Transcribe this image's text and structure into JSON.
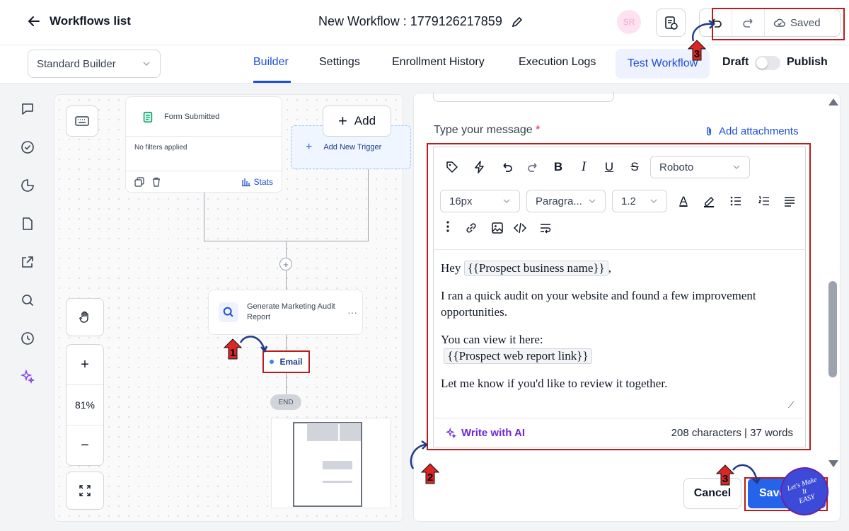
{
  "header": {
    "back_label": "Workflows list",
    "workflow_title": "New Workflow : 1779126217859",
    "avatar_initials": "SR",
    "saved_label": "Saved"
  },
  "tabs": {
    "builder_select": "Standard Builder",
    "items": [
      "Builder",
      "Settings",
      "Enrollment History",
      "Execution Logs"
    ],
    "active": "Builder",
    "test_button": "Test Workflow",
    "draft_label": "Draft",
    "publish_label": "Publish"
  },
  "canvas": {
    "trigger_title": "Form Submitted",
    "trigger_filters": "No filters applied",
    "stats_label": "Stats",
    "add_label": "Add",
    "add_trigger_label": "Add New Trigger",
    "action_label": "Generate Marketing Audit Report",
    "email_label": "Email",
    "end_label": "END",
    "zoom_level": "81%"
  },
  "editor": {
    "message_label": "Type your message",
    "required_mark": "*",
    "attachments_label": "Add attachments",
    "font_family": "Roboto",
    "font_size": "16px",
    "block_format": "Paragra...",
    "line_height": "1.2",
    "content": {
      "greeting": "Hey",
      "var_business": "{{Prospect business name}}",
      "greeting_end": ",",
      "line2": "I ran a quick audit on your website and found a few improvement opportunities.",
      "line3": "You can view it here:",
      "var_link": "{{Prospect web report link}}",
      "line4": "Let me know if you'd like to review it together."
    },
    "ai_label": "Write with AI",
    "char_count": "208 characters | 37 words"
  },
  "footer": {
    "cancel_label": "Cancel",
    "save_label": "Save"
  },
  "annotations": {
    "marker_1": "1",
    "marker_2": "2",
    "marker_3a": "3",
    "marker_3b": "3",
    "watermark": "Let's Make It EASY"
  },
  "colors": {
    "primary": "#2563eb",
    "annotation_red": "#b91c1c",
    "ai_purple": "#6d28d9"
  }
}
